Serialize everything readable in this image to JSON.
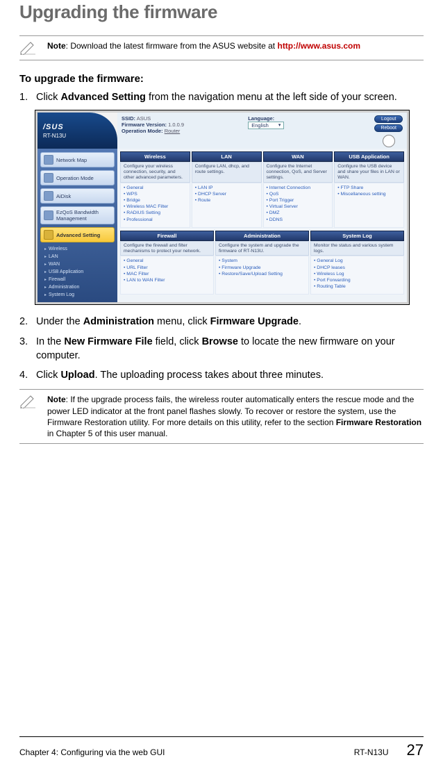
{
  "title": "Upgrading the firmware",
  "note1": {
    "prefix": "Note",
    "body": ": Download the latest firmware from the ASUS website at ",
    "url": "http://www.asus.com"
  },
  "subhead": "To upgrade the firmware:",
  "steps": {
    "s1a": "Click ",
    "s1b": "Advanced Setting",
    "s1c": " from the navigation menu at the left side of your screen.",
    "s2a": "Under the ",
    "s2b": "Administration",
    "s2c": " menu, click ",
    "s2d": "Firmware Upgrade",
    "s2e": ".",
    "s3a": "In the ",
    "s3b": "New Firmware File",
    "s3c": " field, click ",
    "s3d": "Browse",
    "s3e": " to locate the new firmware on your computer.",
    "s4a": "Click ",
    "s4b": "Upload",
    "s4c": ". The uploading process takes about three minutes."
  },
  "note2": {
    "prefix": "Note",
    "body1": ": If the upgrade process fails, the wireless router automatically enters the rescue mode and the power LED indicator at the front panel flashes slowly. To recover or restore the system, use the Firmware Restoration utility. For more details on this utility, refer to the section ",
    "bold": "Firmware Restoration",
    "body2": " in Chapter 5 of this user manual."
  },
  "router": {
    "brand": "/SUS",
    "model": "RT-N13U",
    "info": {
      "ssid_lbl": "SSID:",
      "ssid_val": "ASUS",
      "fw_lbl": "Firmware Version:",
      "fw_val": "1.0.0.9",
      "op_lbl": "Operation Mode:",
      "op_val": "Router",
      "lang_lbl": "Language:",
      "lang_val": "English"
    },
    "buttons": {
      "logout": "Logout",
      "reboot": "Reboot"
    },
    "side": {
      "items": [
        "Network Map",
        "Operation Mode",
        "AiDisk",
        "EzQoS Bandwidth Management",
        "Advanced Setting"
      ],
      "subs": [
        "Wireless",
        "LAN",
        "WAN",
        "USB Application",
        "Firewall",
        "Administration",
        "System Log"
      ]
    },
    "tabs1": [
      "Wireless",
      "LAN",
      "WAN",
      "USB Application"
    ],
    "desc1": [
      "Configure your wireless connection, security, and other advanced parameters.",
      "Configure LAN, dhcp, and route settings.",
      "Configure the Internet connection, QoS, and Server settings.",
      "Configure the USB device and share your files in LAN or WAN."
    ],
    "links1": [
      [
        "General",
        "WPS",
        "Bridge",
        "Wireless MAC Filter",
        "RADIUS Setting",
        "Professional"
      ],
      [
        "LAN IP",
        "DHCP Server",
        "Route"
      ],
      [
        "Internet Connection",
        "QoS",
        "Port Trigger",
        "Virtual Server",
        "DMZ",
        "DDNS"
      ],
      [
        "FTP Share",
        "Miscellaneous setting"
      ]
    ],
    "tabs2": [
      "Firewall",
      "Administration",
      "System Log"
    ],
    "desc2": [
      "Configure the firewall and filter mechanisms to protect your network.",
      "Configure the system and upgrade the firmware of RT-N13U.",
      "Monitor the status and various system logs."
    ],
    "links2": [
      [
        "General",
        "URL Filter",
        "MAC Filter",
        "LAN to WAN Filter"
      ],
      [
        "System",
        "Firmware Upgrade",
        "Restore/Save/Upload Setting"
      ],
      [
        "General Log",
        "DHCP leases",
        "Wireless Log",
        "Port Forwarding",
        "Routing Table"
      ]
    ]
  },
  "footer": {
    "chapter": "Chapter 4: Configuring via the web GUI",
    "model": "RT-N13U",
    "page": "27"
  }
}
